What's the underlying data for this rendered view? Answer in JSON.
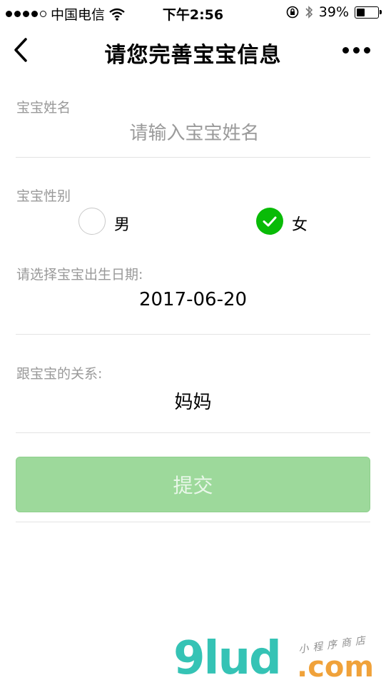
{
  "status": {
    "carrier": "中国电信",
    "time": "下午2:56",
    "battery": "39%",
    "battery_level": 0.39
  },
  "nav": {
    "title": "请您完善宝宝信息"
  },
  "form": {
    "name_label": "宝宝姓名",
    "name_placeholder": "请输入宝宝姓名",
    "name_value": "",
    "gender_label": "宝宝性别",
    "gender_options": [
      "男",
      "女"
    ],
    "gender_selected": "女",
    "date_label": "请选择宝宝出生日期:",
    "date_value": "2017-06-20",
    "relation_label": "跟宝宝的关系:",
    "relation_value": "妈妈",
    "submit_label": "提交"
  },
  "watermark": {
    "brand": "9lud",
    "domain": ".com",
    "subtitle": "小程序商店"
  },
  "colors": {
    "accent": "#09bb07",
    "submit_bg": "#9dd99b",
    "watermark_teal": "#35c3b5",
    "watermark_orange": "#f0a23a"
  }
}
